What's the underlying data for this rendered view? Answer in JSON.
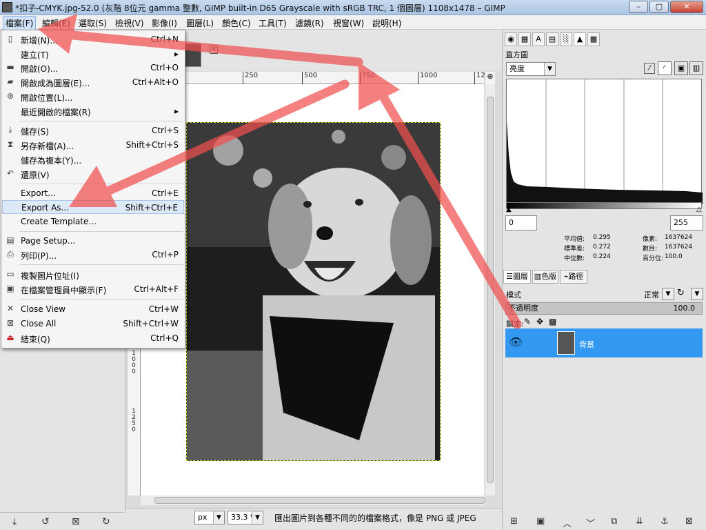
{
  "window": {
    "title": "*扣子-CMYK.jpg-52.0 (灰階 8位元 gamma 整數, GIMP built-in D65 Grayscale with sRGB TRC, 1 個圖層) 1108x1478 – GIMP",
    "minimize": "–",
    "maximize": "□",
    "close": "✕"
  },
  "menubar": [
    "檔案(F)",
    "編輯(E)",
    "選取(S)",
    "檢視(V)",
    "影像(I)",
    "圖層(L)",
    "顏色(C)",
    "工具(T)",
    "濾鏡(R)",
    "視窗(W)",
    "說明(H)"
  ],
  "file_menu": [
    {
      "label": "新增(N)...",
      "accel": "Ctrl+N",
      "icon": "new-icon"
    },
    {
      "label": "建立(T)",
      "accel": "▸",
      "icon": ""
    },
    {
      "label": "開啟(O)...",
      "accel": "Ctrl+O",
      "icon": "open-icon"
    },
    {
      "label": "開啟成為圖層(E)...",
      "accel": "Ctrl+Alt+O",
      "icon": "open-layer-icon"
    },
    {
      "label": "開啟位置(L)...",
      "accel": "",
      "icon": "location-icon"
    },
    {
      "label": "最近開啟的檔案(R)",
      "accel": "▸",
      "icon": ""
    },
    {
      "label": "儲存(S)",
      "accel": "Ctrl+S",
      "icon": "save-icon"
    },
    {
      "label": "另存新檔(A)...",
      "accel": "Shift+Ctrl+S",
      "icon": "save-as-icon"
    },
    {
      "label": "儲存為複本(Y)...",
      "accel": "",
      "icon": ""
    },
    {
      "label": "還原(V)",
      "accel": "",
      "icon": "revert-icon"
    },
    {
      "label": "Export...",
      "accel": "Ctrl+E",
      "icon": ""
    },
    {
      "label": "Export As...",
      "accel": "Shift+Ctrl+E",
      "icon": ""
    },
    {
      "label": "Create Template...",
      "accel": "",
      "icon": ""
    },
    {
      "label": "Page Setup...",
      "accel": "",
      "icon": "page-setup-icon"
    },
    {
      "label": "列印(P)...",
      "accel": "Ctrl+P",
      "icon": "print-icon"
    },
    {
      "label": "複製圖片位址(I)",
      "accel": "",
      "icon": "copy-location-icon"
    },
    {
      "label": "在檔案管理員中顯示(F)",
      "accel": "Ctrl+Alt+F",
      "icon": "file-manager-icon"
    },
    {
      "label": "Close View",
      "accel": "Ctrl+W",
      "icon": "close-view-icon"
    },
    {
      "label": "Close All",
      "accel": "Shift+Ctrl+W",
      "icon": "close-all-icon"
    },
    {
      "label": "結束(Q)",
      "accel": "Ctrl+Q",
      "icon": "quit-icon"
    }
  ],
  "ruler_h": [
    "250",
    "500",
    "750",
    "1000",
    "12"
  ],
  "ruler_v": [
    "1000",
    "1250"
  ],
  "status": {
    "unit": "px",
    "zoom": "33.3 %",
    "message": "匯出圖片到各種不同的的檔案格式，像是 PNG 或 JPEG"
  },
  "histogram": {
    "title": "直方圖",
    "channel": "亮度",
    "range_low": "0",
    "range_high": "255",
    "stats": [
      {
        "label": "平均值:",
        "value": "0.295"
      },
      {
        "label": "標準差:",
        "value": "0.272"
      },
      {
        "label": "中位數:",
        "value": "0.224"
      },
      {
        "label": "像素:",
        "value": "1637624"
      },
      {
        "label": "數目:",
        "value": "1637624"
      },
      {
        "label": "百分位:",
        "value": "100.0"
      }
    ]
  },
  "layers": {
    "tabs": [
      "圖層",
      "色版",
      "路徑"
    ],
    "mode_label": "模式",
    "mode_value": "正常",
    "opacity_label": "不透明度",
    "opacity_value": "100.0",
    "lock_label": "鎖定:",
    "layer_name": "背景"
  },
  "colors": {
    "accent": "#3399f0",
    "arrow": "#f05050"
  }
}
